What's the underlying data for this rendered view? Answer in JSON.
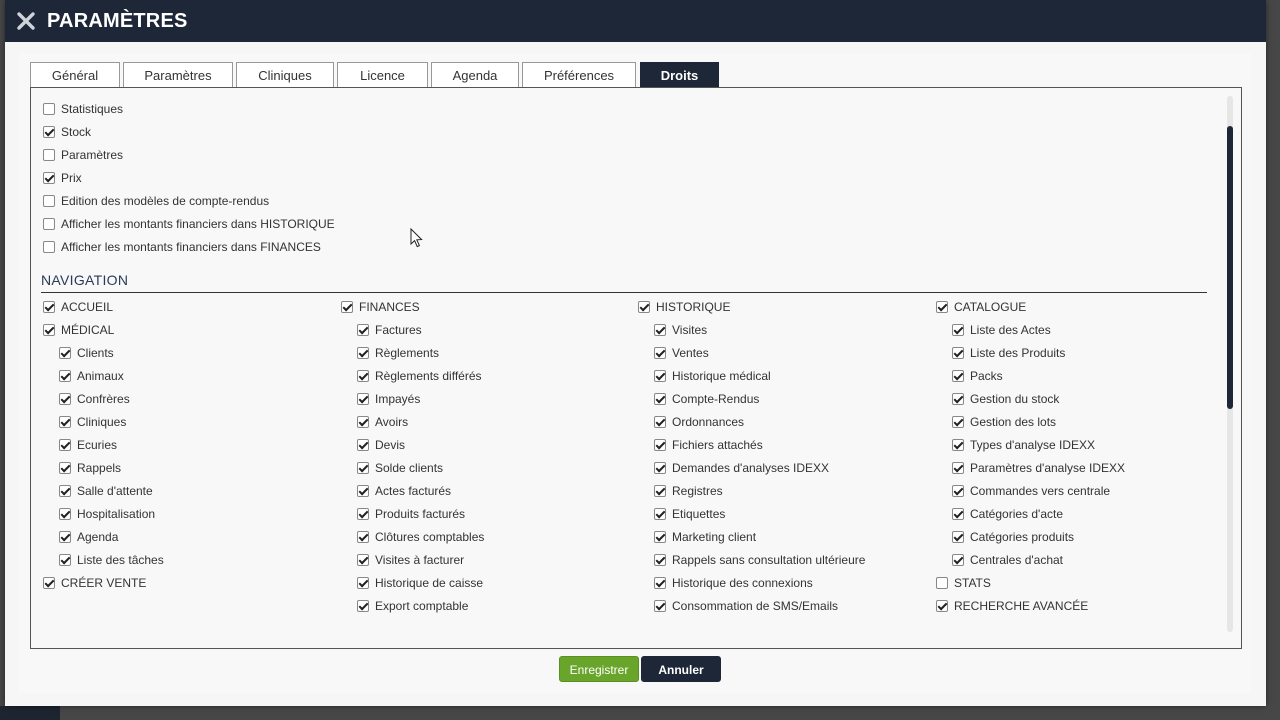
{
  "header": {
    "title": "PARAMÈTRES",
    "close_icon": "close-icon"
  },
  "tabs": [
    {
      "label": "Général",
      "active": false
    },
    {
      "label": "Paramètres",
      "active": false
    },
    {
      "label": "Cliniques",
      "active": false
    },
    {
      "label": "Licence",
      "active": false
    },
    {
      "label": "Agenda",
      "active": false
    },
    {
      "label": "Préférences",
      "active": false
    },
    {
      "label": "Droits",
      "active": true
    }
  ],
  "top_rights": [
    {
      "label": "Statistiques",
      "checked": false
    },
    {
      "label": "Stock",
      "checked": true
    },
    {
      "label": "Paramètres",
      "checked": false
    },
    {
      "label": "Prix",
      "checked": true
    },
    {
      "label": "Edition des modèles de compte-rendus",
      "checked": false
    },
    {
      "label": "Afficher les montants financiers dans HISTORIQUE",
      "checked": false
    },
    {
      "label": "Afficher les montants financiers dans FINANCES",
      "checked": false
    }
  ],
  "navigation": {
    "title": "NAVIGATION",
    "columns": [
      [
        {
          "label": "ACCUEIL",
          "checked": true,
          "level": 0
        },
        {
          "label": "MÉDICAL",
          "checked": true,
          "level": 0
        },
        {
          "label": "Clients",
          "checked": true,
          "level": 1
        },
        {
          "label": "Animaux",
          "checked": true,
          "level": 1
        },
        {
          "label": "Confrères",
          "checked": true,
          "level": 1
        },
        {
          "label": "Cliniques",
          "checked": true,
          "level": 1
        },
        {
          "label": "Ecuries",
          "checked": true,
          "level": 1
        },
        {
          "label": "Rappels",
          "checked": true,
          "level": 1
        },
        {
          "label": "Salle d'attente",
          "checked": true,
          "level": 1
        },
        {
          "label": "Hospitalisation",
          "checked": true,
          "level": 1
        },
        {
          "label": "Agenda",
          "checked": true,
          "level": 1
        },
        {
          "label": "Liste des tâches",
          "checked": true,
          "level": 1
        },
        {
          "label": "CRÉER VENTE",
          "checked": true,
          "level": 0
        }
      ],
      [
        {
          "label": "FINANCES",
          "checked": true,
          "level": 0
        },
        {
          "label": "Factures",
          "checked": true,
          "level": 1
        },
        {
          "label": "Règlements",
          "checked": true,
          "level": 1
        },
        {
          "label": "Règlements différés",
          "checked": true,
          "level": 1
        },
        {
          "label": "Impayés",
          "checked": true,
          "level": 1
        },
        {
          "label": "Avoirs",
          "checked": true,
          "level": 1
        },
        {
          "label": "Devis",
          "checked": true,
          "level": 1
        },
        {
          "label": "Solde clients",
          "checked": true,
          "level": 1
        },
        {
          "label": "Actes facturés",
          "checked": true,
          "level": 1
        },
        {
          "label": "Produits facturés",
          "checked": true,
          "level": 1
        },
        {
          "label": "Clôtures comptables",
          "checked": true,
          "level": 1
        },
        {
          "label": "Visites à facturer",
          "checked": true,
          "level": 1
        },
        {
          "label": "Historique de caisse",
          "checked": true,
          "level": 1
        },
        {
          "label": "Export comptable",
          "checked": true,
          "level": 1
        }
      ],
      [
        {
          "label": "HISTORIQUE",
          "checked": true,
          "level": 0
        },
        {
          "label": "Visites",
          "checked": true,
          "level": 1
        },
        {
          "label": "Ventes",
          "checked": true,
          "level": 1
        },
        {
          "label": "Historique médical",
          "checked": true,
          "level": 1
        },
        {
          "label": "Compte-Rendus",
          "checked": true,
          "level": 1
        },
        {
          "label": "Ordonnances",
          "checked": true,
          "level": 1
        },
        {
          "label": "Fichiers attachés",
          "checked": true,
          "level": 1
        },
        {
          "label": "Demandes d'analyses IDEXX",
          "checked": true,
          "level": 1
        },
        {
          "label": "Registres",
          "checked": true,
          "level": 1
        },
        {
          "label": "Etiquettes",
          "checked": true,
          "level": 1
        },
        {
          "label": "Marketing client",
          "checked": true,
          "level": 1
        },
        {
          "label": "Rappels sans consultation ultérieure",
          "checked": true,
          "level": 1
        },
        {
          "label": "Historique des connexions",
          "checked": true,
          "level": 1
        },
        {
          "label": "Consommation de SMS/Emails",
          "checked": true,
          "level": 1
        }
      ],
      [
        {
          "label": "CATALOGUE",
          "checked": true,
          "level": 0
        },
        {
          "label": "Liste des Actes",
          "checked": true,
          "level": 1
        },
        {
          "label": "Liste des Produits",
          "checked": true,
          "level": 1
        },
        {
          "label": "Packs",
          "checked": true,
          "level": 1
        },
        {
          "label": "Gestion du stock",
          "checked": true,
          "level": 1
        },
        {
          "label": "Gestion des lots",
          "checked": true,
          "level": 1
        },
        {
          "label": "Types d'analyse IDEXX",
          "checked": true,
          "level": 1
        },
        {
          "label": "Paramètres d'analyse IDEXX",
          "checked": true,
          "level": 1
        },
        {
          "label": "Commandes vers centrale",
          "checked": true,
          "level": 1
        },
        {
          "label": "Catégories d'acte",
          "checked": true,
          "level": 1
        },
        {
          "label": "Catégories produits",
          "checked": true,
          "level": 1
        },
        {
          "label": "Centrales d'achat",
          "checked": true,
          "level": 1
        },
        {
          "label": "STATS",
          "checked": false,
          "level": 0
        },
        {
          "label": "RECHERCHE AVANCÉE",
          "checked": true,
          "level": 0
        }
      ]
    ]
  },
  "footer": {
    "save_label": "Enregistrer",
    "cancel_label": "Annuler"
  },
  "colors": {
    "header_bg": "#1e2737",
    "save_bg": "#69a52b",
    "tab_active_bg": "#1e2737"
  }
}
